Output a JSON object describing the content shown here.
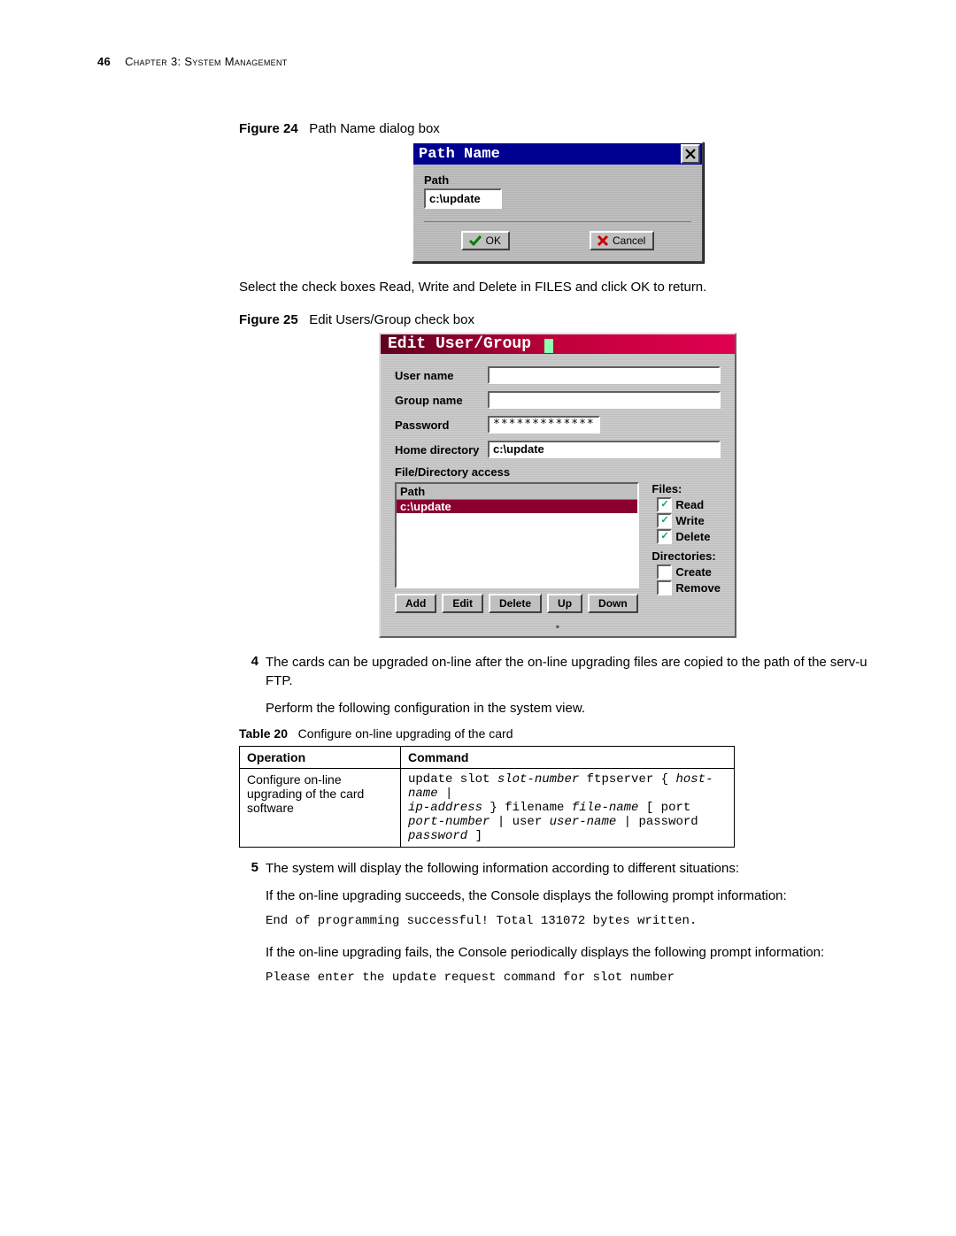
{
  "header": {
    "page_number": "46",
    "chapter": "Chapter 3: System Management"
  },
  "fig24": {
    "caption_prefix": "Figure 24",
    "caption": "Path Name dialog box",
    "title": "Path Name",
    "path_label": "Path",
    "path_value": "c:\\update",
    "ok_label": "OK",
    "cancel_label": "Cancel"
  },
  "para1": "Select the check boxes Read, Write and Delete in FILES and click OK to return.",
  "fig25": {
    "caption_prefix": "Figure 25",
    "caption": "Edit Users/Group check box",
    "title": "Edit User/Group",
    "user_name_label": "User name",
    "group_name_label": "Group name",
    "password_label": "Password",
    "password_value": "*************",
    "home_dir_label": "Home directory",
    "home_dir_value": "c:\\update",
    "file_dir_access": "File/Directory access",
    "path_header": "Path",
    "path_selected": "c:\\update",
    "files_header": "Files:",
    "cb_read": "Read",
    "cb_write": "Write",
    "cb_delete": "Delete",
    "dirs_header": "Directories:",
    "cb_create": "Create",
    "cb_remove": "Remove",
    "btn_add": "Add",
    "btn_edit": "Edit",
    "btn_delete": "Delete",
    "btn_up": "Up",
    "btn_down": "Down"
  },
  "step4": {
    "num": "4",
    "a": "The cards can be upgraded on-line after the on-line upgrading files are copied to the path of the serv-u FTP.",
    "b": "Perform the following configuration in the system view."
  },
  "table20": {
    "cap_prefix": "Table 20",
    "caption": "Configure on-line upgrading of the card",
    "col_operation": "Operation",
    "col_command": "Command",
    "op_cell": "Configure on-line upgrading of the card software",
    "cmd": {
      "k_update": "update slot ",
      "v_slot": "slot-number",
      "k_ftps": " ftpserver { ",
      "v_host": "host-name",
      "pipe1": " | ",
      "v_ip": "ip-address",
      "k_rb_fn": " } filename ",
      "v_file": "file-name",
      "k_lb": " [ port ",
      "v_port": "port-number",
      "pipe2": " | user ",
      "v_user": "user-name",
      "pipe3": " | password ",
      "v_pass": "password",
      "k_end": " ]"
    }
  },
  "step5": {
    "num": "5",
    "a": "The system will display the following information according to different situations:",
    "b": "If the on-line upgrading succeeds, the Console displays the following prompt information:",
    "out1": "End of programming successful! Total 131072 bytes written.",
    "c": "If the on-line upgrading fails, the Console periodically displays the following prompt information:",
    "out2": "Please enter the update request command for slot number"
  }
}
